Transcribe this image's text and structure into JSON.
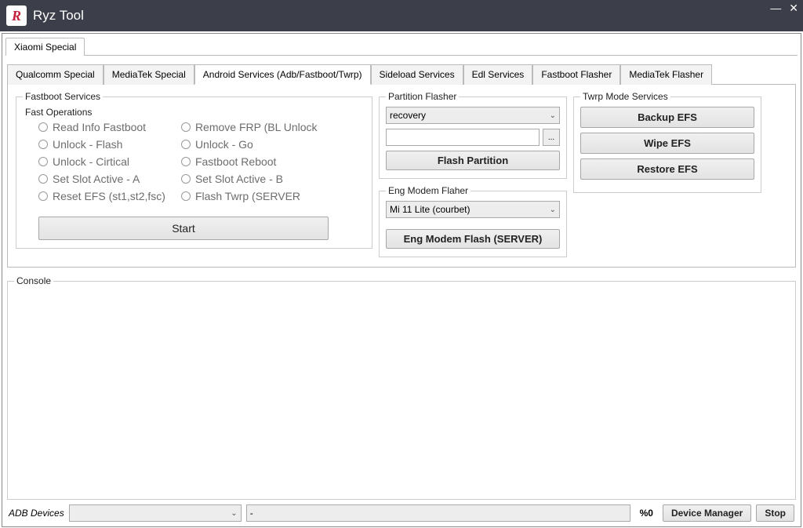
{
  "titlebar": {
    "app_name": "Ryz Tool",
    "logo_letter": "R"
  },
  "main_tabs": {
    "xiaomi": "Xiaomi Special"
  },
  "sub_tabs": {
    "qualcomm": "Qualcomm Special",
    "mediatek": "MediaTek Special",
    "android_services": "Android Services (Adb/Fastboot/Twrp)",
    "sideload": "Sideload Services",
    "edl": "Edl Services",
    "fastboot_flasher": "Fastboot Flasher",
    "mediatek_flasher": "MediaTek Flasher"
  },
  "fastboot_services": {
    "legend": "Fastboot Services",
    "fast_ops_legend": "Fast Operations",
    "options_col1": [
      "Read Info Fastboot",
      "Unlock - Flash",
      "Unlock - Cirtical",
      "Set Slot Active - A",
      "Reset EFS (st1,st2,fsc)"
    ],
    "options_col2": [
      "Remove FRP (BL Unlock",
      "Unlock - Go",
      "Fastboot Reboot",
      "Set Slot Active - B",
      "Flash Twrp (SERVER"
    ],
    "start_btn": "Start"
  },
  "partition_flasher": {
    "legend": "Partition Flasher",
    "selected": "recovery",
    "flash_btn": "Flash Partition"
  },
  "eng_modem": {
    "legend": "Eng Modem Flaher",
    "selected": "Mi 11 Lite (courbet)",
    "flash_btn": "Eng Modem Flash (SERVER)"
  },
  "twrp_services": {
    "legend": "Twrp Mode Services",
    "backup": "Backup EFS",
    "wipe": "Wipe EFS",
    "restore": "Restore EFS"
  },
  "console": {
    "legend": "Console"
  },
  "bottom": {
    "adb_label": "ADB Devices",
    "status": "-",
    "percent": "%0",
    "device_manager": "Device Manager",
    "stop": "Stop"
  }
}
